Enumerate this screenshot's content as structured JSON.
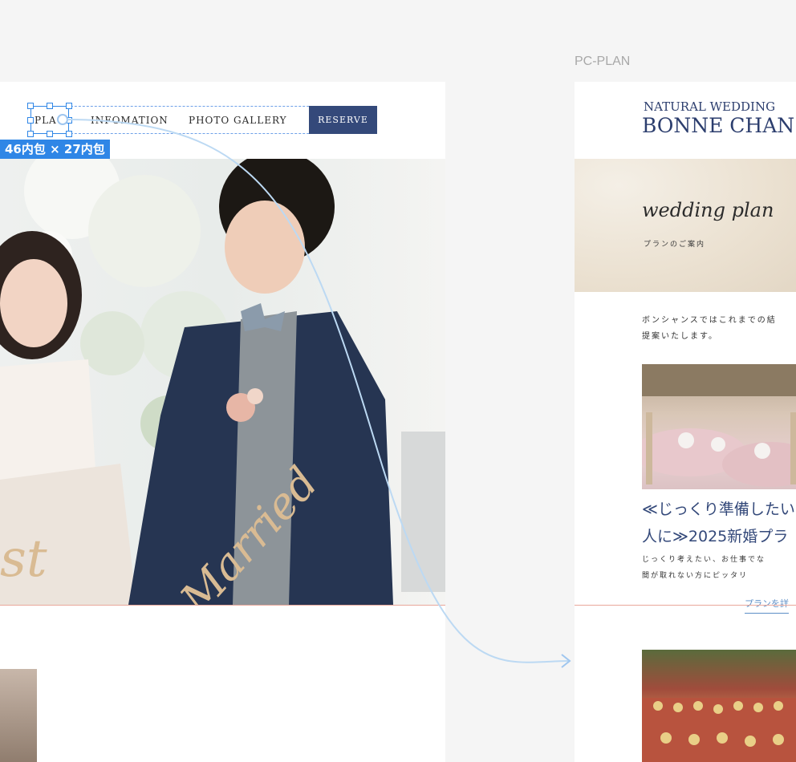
{
  "left": {
    "nav": {
      "items": [
        "PLA",
        "INFOMATION",
        "PHOTO GALLERY"
      ],
      "reserve_label": "RESERVE"
    },
    "size_label": "46内包 × 27内包",
    "hero_text": [
      "st",
      "Married"
    ]
  },
  "right": {
    "frame_label": "PC-PLAN",
    "logo": {
      "small": "NATURAL WEDDING",
      "big": "BONNE CHAN"
    },
    "banner": {
      "script": "wedding plan",
      "sub": "プランのご案内"
    },
    "intro": [
      "ボンシャンスではこれまでの結",
      "提案いたします。"
    ],
    "plan": {
      "title": [
        "≪じっくり準備したい",
        "人に≫2025新婚プラ"
      ],
      "desc": [
        "じっくり考えたい、お仕事でな",
        "間が取れない方にピッタリ"
      ],
      "link": "プランを詳"
    }
  },
  "colors": {
    "accent": "#34497a",
    "selection": "#2f86e6",
    "divider": "#e9a79a",
    "link": "#5d8fc7"
  }
}
